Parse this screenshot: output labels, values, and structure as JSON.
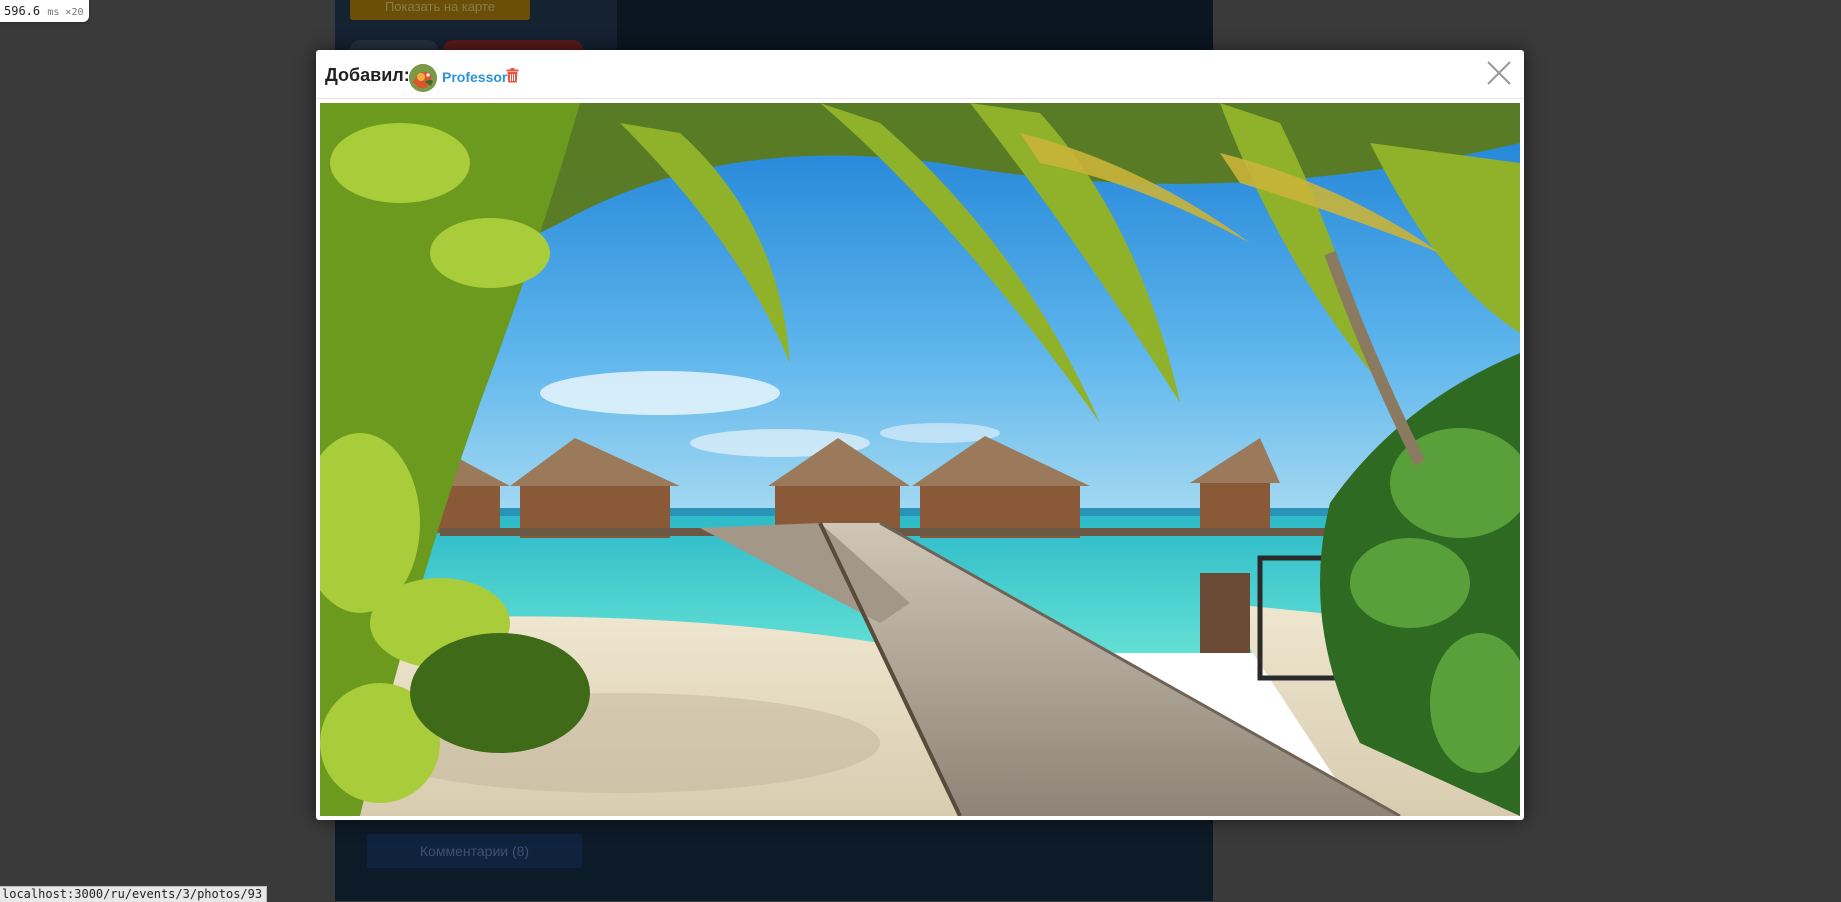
{
  "timer": {
    "value": "596.6",
    "unit": "ms ×20"
  },
  "background": {
    "top_button_label": "Показать на карте",
    "comments_label": "Комментарии (8)"
  },
  "modal": {
    "added_by_label": "Добавил:",
    "user_name": "Professor",
    "close_icon": "close-x-icon",
    "delete_icon": "trash-icon",
    "delete_color": "#e8533c",
    "link_color": "#2d93d8"
  },
  "status_bar": {
    "url": "localhost:3000/ru/events/3/photos/93"
  }
}
